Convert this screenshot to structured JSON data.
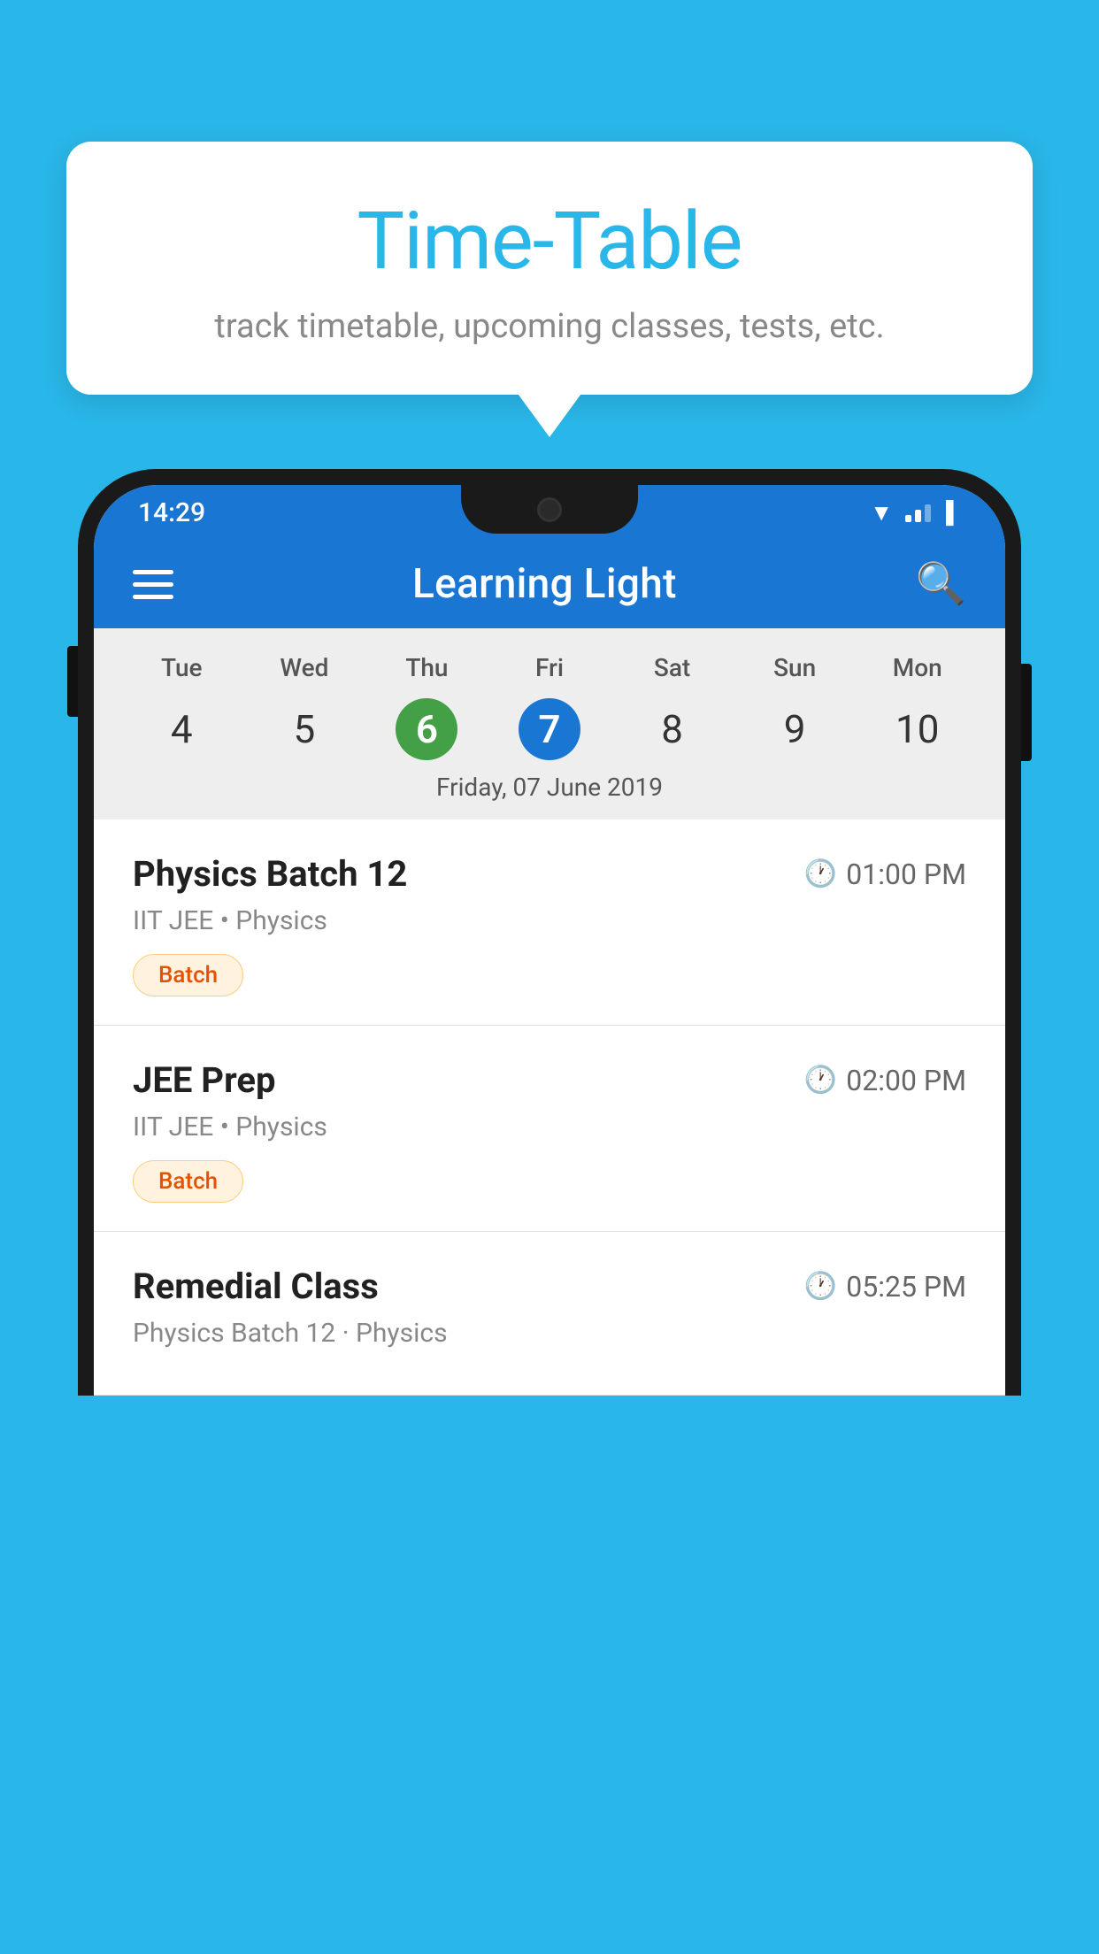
{
  "background_color": "#29b6e8",
  "tooltip": {
    "title": "Time-Table",
    "subtitle": "track timetable, upcoming classes, tests, etc."
  },
  "phone": {
    "status_bar": {
      "time": "14:29"
    },
    "app_bar": {
      "title": "Learning Light"
    },
    "calendar": {
      "days": [
        "Tue",
        "Wed",
        "Thu",
        "Fri",
        "Sat",
        "Sun",
        "Mon"
      ],
      "numbers": [
        "4",
        "5",
        "6",
        "7",
        "8",
        "9",
        "10"
      ],
      "today_index": 2,
      "selected_index": 3,
      "selected_date_label": "Friday, 07 June 2019"
    },
    "schedule": [
      {
        "title": "Physics Batch 12",
        "time": "01:00 PM",
        "subtitle": "IIT JEE • Physics",
        "badge": "Batch"
      },
      {
        "title": "JEE Prep",
        "time": "02:00 PM",
        "subtitle": "IIT JEE • Physics",
        "badge": "Batch"
      },
      {
        "title": "Remedial Class",
        "time": "05:25 PM",
        "subtitle": "Physics Batch 12 · Physics",
        "badge": ""
      }
    ]
  }
}
